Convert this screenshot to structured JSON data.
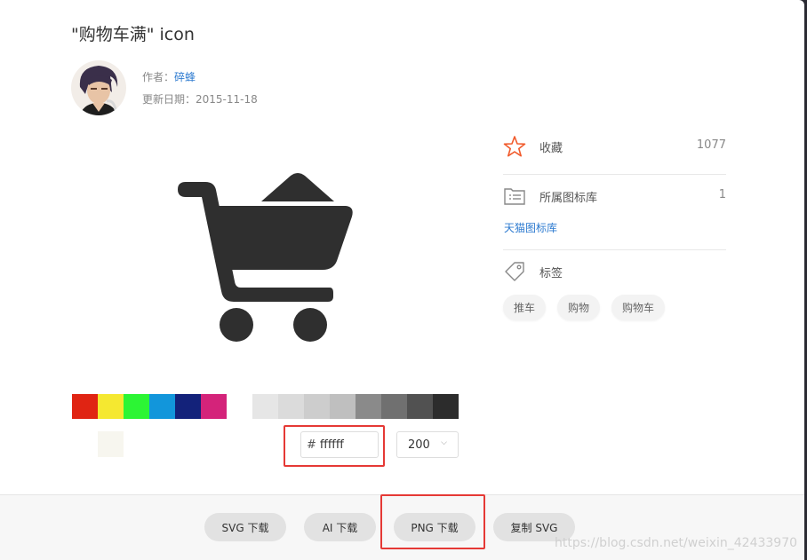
{
  "title": "\"购物车满\" icon",
  "author": {
    "label": "作者：",
    "name": "碎蜂"
  },
  "updated": {
    "label": "更新日期：",
    "date": "2015-11-18"
  },
  "icon_name": "cart-full-icon",
  "palette": [
    "#e02413",
    "#f5e830",
    "#2cf534",
    "#1296db",
    "#13227a",
    "#d4237a",
    "#ffffff",
    "#e6e6e6",
    "#dbdbdb",
    "#cdcdcd",
    "#bfbfbf",
    "#8a8a8a",
    "#707070",
    "#515151",
    "#2c2c2c"
  ],
  "custom_swatches": [
    "#ffffff",
    "#f7f6ef"
  ],
  "color_input": {
    "hash": "#",
    "value": "ffffff"
  },
  "size_select": {
    "value": "200",
    "chevron": "⌵"
  },
  "sidebar": {
    "favorite": {
      "label": "收藏",
      "count": "1077",
      "icon": "star-icon",
      "color": "#f15a2b"
    },
    "library": {
      "label": "所属图标库",
      "count": "1",
      "link": "天猫图标库",
      "icon": "library-icon"
    },
    "tags": {
      "label": "标签",
      "icon": "tag-icon",
      "items": [
        "推车",
        "购物",
        "购物车"
      ]
    }
  },
  "footer": {
    "buttons": [
      "SVG 下载",
      "AI 下载",
      "PNG 下载",
      "复制 SVG"
    ]
  },
  "watermark": "https://blog.csdn.net/weixin_42433970"
}
